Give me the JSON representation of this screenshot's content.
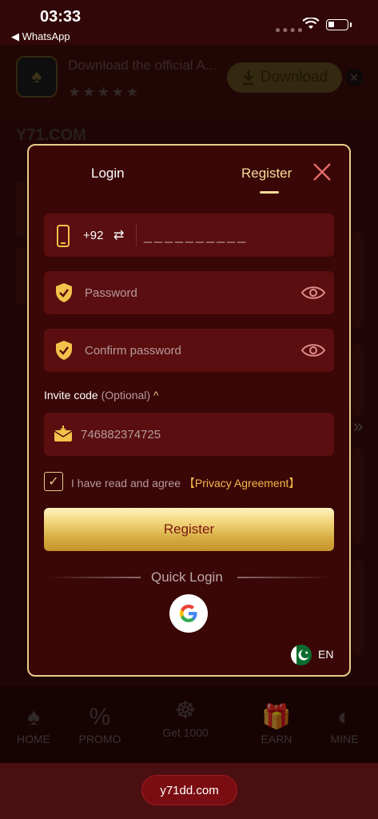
{
  "status_bar": {
    "time": "03:33",
    "back_app": "◀ WhatsApp"
  },
  "banner": {
    "text": "Download the official A...",
    "stars": "★★★★★",
    "download_label": "Download",
    "close_glyph": "✕"
  },
  "site": {
    "logo_text": "Y71.COM"
  },
  "modal": {
    "tabs": [
      "Login",
      "Register"
    ],
    "active_tab": "Register",
    "phone": {
      "country_code": "+92",
      "mask": "__________"
    },
    "password_placeholder": "Password",
    "confirm_placeholder": "Confirm password",
    "invite": {
      "label": "Invite code",
      "optional": "(Optional)",
      "caret": "^",
      "value": "746882374725"
    },
    "agree": {
      "checked": true,
      "text": "I have read and agree",
      "link": "【Privacy Agreement】"
    },
    "register_label": "Register",
    "quick_login_label": "Quick Login",
    "language": "EN"
  },
  "bottom_nav": {
    "items": [
      {
        "label": "HOME",
        "icon": "spade-icon"
      },
      {
        "label": "PROMO",
        "icon": "promo-icon"
      },
      {
        "label": "Get 1000",
        "icon": "wheel-icon"
      },
      {
        "label": "EARN",
        "icon": "gift-icon"
      },
      {
        "label": "MINE",
        "icon": "mine-icon"
      }
    ]
  },
  "url": "y71dd.com",
  "colors": {
    "accent_gold": "#e6cc8a",
    "modal_bg": "#3a0606",
    "field_bg": "#5a0e10",
    "link": "#f6b84a"
  }
}
